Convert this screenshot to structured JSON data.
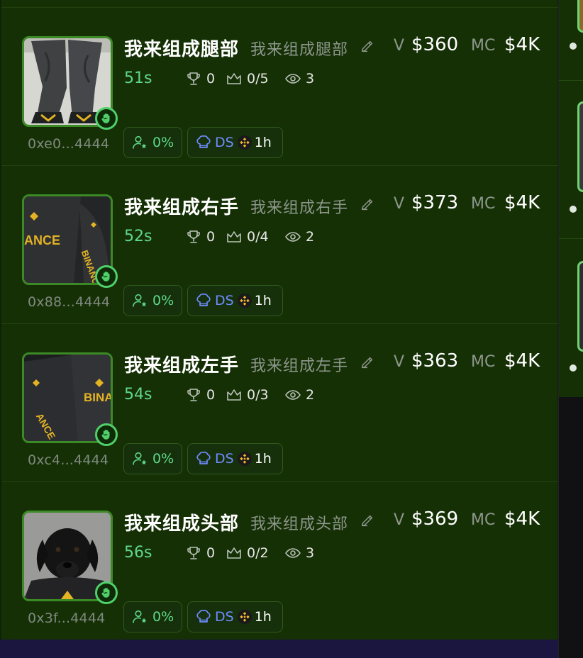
{
  "colors": {
    "panel_bg": "#163006",
    "accent_green": "#5fd88a",
    "ds_blue": "#6e8cff",
    "muted_text": "#8d978c",
    "bnb_gold": "#f3ba2f"
  },
  "icons": {
    "edit": "pencil-icon",
    "trophy": "trophy-icon",
    "crown": "crown-icon",
    "views": "eye-icon",
    "holders": "user-star-icon",
    "ds": "chef-hat-icon",
    "bnb": "bnb-icon",
    "badge": "hand-icon"
  },
  "rows": [
    {
      "name": "我来组成腿部",
      "subname": "我来组成腿部",
      "v_label": "V",
      "volume": "$360",
      "mc_label": "MC",
      "market_cap": "$4K",
      "age": "51s",
      "trophies": "0",
      "crowns": "0/5",
      "views": "3",
      "address": "0xe0...4444",
      "holders_pct": "0%",
      "ds_label": "DS",
      "ds_time": "1h",
      "image": "legs"
    },
    {
      "name": "我来组成右手",
      "subname": "我来组成右手",
      "v_label": "V",
      "volume": "$373",
      "mc_label": "MC",
      "market_cap": "$4K",
      "age": "52s",
      "trophies": "0",
      "crowns": "0/4",
      "views": "2",
      "address": "0x88...4444",
      "holders_pct": "0%",
      "ds_label": "DS",
      "ds_time": "1h",
      "image": "right-arm"
    },
    {
      "name": "我来组成左手",
      "subname": "我来组成左手",
      "v_label": "V",
      "volume": "$363",
      "mc_label": "MC",
      "market_cap": "$4K",
      "age": "54s",
      "trophies": "0",
      "crowns": "0/3",
      "views": "2",
      "address": "0xc4...4444",
      "holders_pct": "0%",
      "ds_label": "DS",
      "ds_time": "1h",
      "image": "left-arm"
    },
    {
      "name": "我来组成头部",
      "subname": "我来组成头部",
      "v_label": "V",
      "volume": "$369",
      "mc_label": "MC",
      "market_cap": "$4K",
      "age": "56s",
      "trophies": "0",
      "crowns": "0/2",
      "views": "3",
      "address": "0x3f...4444",
      "holders_pct": "0%",
      "ds_label": "DS",
      "ds_time": "1h",
      "image": "dog-head"
    }
  ]
}
